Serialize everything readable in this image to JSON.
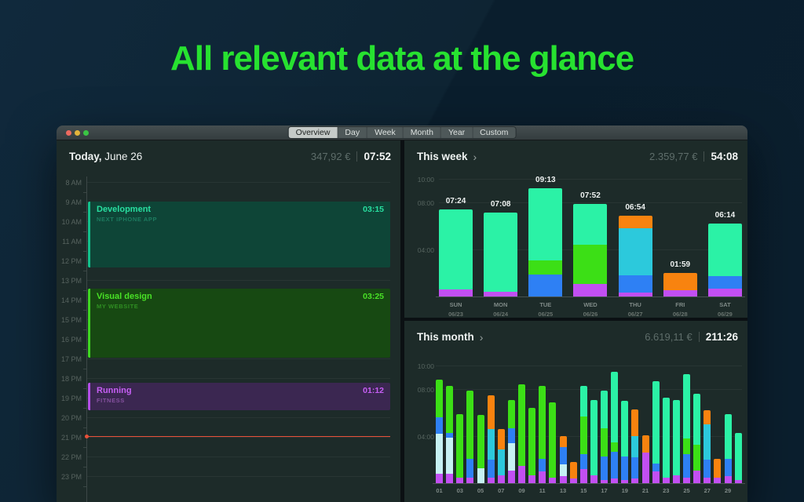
{
  "page": {
    "headline": "All relevant data at the glance"
  },
  "colors": {
    "headline": "#27e230",
    "panel_bg": "#1d2b29",
    "now_line": "#e85039",
    "traffic_lights": {
      "close": "#ed6a5f",
      "minimize": "#e2b43b",
      "zoom": "#3ac544"
    },
    "palette": {
      "m": "#2bf2a6",
      "g": "#3cdf16",
      "b": "#2e80f4",
      "c": "#2cc9dc",
      "lc": "#c6f1f3",
      "o": "#f8830f",
      "p": "#c24ff2"
    },
    "event_themes": {
      "teal": {
        "bg": "#0e4537",
        "border": "#13c18c",
        "title": "#28dfa0",
        "sub": "#1d7c60"
      },
      "green": {
        "bg": "#174912",
        "border": "#3fd622",
        "title": "#49e126",
        "sub": "#2f8f22"
      },
      "purple": {
        "bg": "#3b2751",
        "border": "#b44fe8",
        "title": "#c75ff5",
        "sub": "#85519f"
      }
    }
  },
  "window": {
    "tabs": [
      {
        "label": "Overview",
        "selected": true
      },
      {
        "label": "Day",
        "selected": false
      },
      {
        "label": "Week",
        "selected": false
      },
      {
        "label": "Month",
        "selected": false
      },
      {
        "label": "Year",
        "selected": false
      },
      {
        "label": "Custom",
        "selected": false
      }
    ]
  },
  "today": {
    "title_bold": "Today,",
    "title_rest": " June 26",
    "amount": "347,92 €",
    "duration": "07:52",
    "hours": [
      "8 AM",
      "9 AM",
      "10 AM",
      "11 AM",
      "12 PM",
      "13 PM",
      "14 PM",
      "15 PM",
      "16 PM",
      "17 PM",
      "18 PM",
      "19 PM",
      "20 PM",
      "21 PM",
      "22 PM",
      "23 PM"
    ],
    "events": [
      {
        "name": "Development",
        "project": "NEXT IPHONE APP",
        "duration": "03:15",
        "start": 9.0,
        "end": 12.35,
        "theme": "teal"
      },
      {
        "name": "Visual design",
        "project": "MY WEBSITE",
        "duration": "03:25",
        "start": 13.45,
        "end": 16.95,
        "theme": "green"
      },
      {
        "name": "Running",
        "project": "FITNESS",
        "duration": "01:12",
        "start": 18.25,
        "end": 19.65,
        "theme": "purple"
      }
    ],
    "now_line_hour": 20.95
  },
  "chart_data": [
    {
      "type": "bar",
      "stacked": true,
      "title": "This week",
      "chevron": "›",
      "amount": "2.359,77 €",
      "total_duration": "54:08",
      "ylim": [
        0,
        10
      ],
      "ytick_labels": [
        "10:00",
        "08:00",
        "04:00"
      ],
      "ytick_hours": [
        10,
        8,
        4
      ],
      "grid": true,
      "legend": "none",
      "categories": [
        [
          "SUN",
          "06/23"
        ],
        [
          "MON",
          "06/24"
        ],
        [
          "TUE",
          "06/25"
        ],
        [
          "WED",
          "06/26"
        ],
        [
          "THU",
          "06/27"
        ],
        [
          "FRI",
          "06/28"
        ],
        [
          "SAT",
          "06/29"
        ]
      ],
      "bar_value_labels": [
        "07:24",
        "07:08",
        "09:13",
        "07:52",
        "06:54",
        "01:59",
        "06:14"
      ],
      "bars": [
        {
          "segments": [
            [
              "p",
              0.6
            ],
            [
              "m",
              6.8
            ]
          ]
        },
        {
          "segments": [
            [
              "p",
              0.4
            ],
            [
              "m",
              6.73
            ]
          ]
        },
        {
          "segments": [
            [
              "b",
              1.9
            ],
            [
              "g",
              1.2
            ],
            [
              "m",
              6.12
            ]
          ]
        },
        {
          "segments": [
            [
              "p",
              1.1
            ],
            [
              "g",
              3.3
            ],
            [
              "m",
              3.47
            ]
          ]
        },
        {
          "segments": [
            [
              "p",
              0.35
            ],
            [
              "b",
              1.45
            ],
            [
              "c",
              4.0
            ],
            [
              "o",
              1.1
            ]
          ]
        },
        {
          "segments": [
            [
              "p",
              0.55
            ],
            [
              "o",
              1.43
            ]
          ]
        },
        {
          "segments": [
            [
              "p",
              0.65
            ],
            [
              "b",
              1.1
            ],
            [
              "m",
              4.48
            ]
          ]
        }
      ]
    },
    {
      "type": "bar",
      "stacked": true,
      "title": "This month",
      "chevron": "›",
      "amount": "6.619,11 €",
      "total_duration": "211:26",
      "ylim": [
        0,
        10
      ],
      "ytick_labels": [
        "10:00",
        "08:00",
        "04:00"
      ],
      "ytick_hours": [
        10,
        8,
        4
      ],
      "grid": true,
      "legend": "none",
      "xtick_labels": [
        "01",
        "03",
        "05",
        "07",
        "09",
        "11",
        "13",
        "15",
        "17",
        "19",
        "21",
        "23",
        "25",
        "27",
        "29"
      ],
      "bars": [
        {
          "day": "01",
          "segments": [
            [
              "p",
              0.8
            ],
            [
              "lc",
              3.4
            ],
            [
              "b",
              1.4
            ],
            [
              "g",
              3.2
            ]
          ]
        },
        {
          "day": "02",
          "segments": [
            [
              "p",
              0.8
            ],
            [
              "lc",
              3.1
            ],
            [
              "b",
              0.4
            ],
            [
              "g",
              4.0
            ]
          ]
        },
        {
          "day": "03",
          "segments": [
            [
              "p",
              0.5
            ],
            [
              "g",
              5.4
            ]
          ]
        },
        {
          "day": "04",
          "segments": [
            [
              "p",
              0.5
            ],
            [
              "b",
              1.6
            ],
            [
              "g",
              5.8
            ]
          ]
        },
        {
          "day": "05",
          "segments": [
            [
              "lc",
              1.3
            ],
            [
              "g",
              4.5
            ]
          ]
        },
        {
          "day": "06",
          "segments": [
            [
              "p",
              0.5
            ],
            [
              "b",
              1.5
            ],
            [
              "c",
              2.6
            ],
            [
              "o",
              2.9
            ]
          ]
        },
        {
          "day": "07",
          "segments": [
            [
              "p",
              0.7
            ],
            [
              "c",
              2.2
            ],
            [
              "o",
              1.7
            ]
          ]
        },
        {
          "day": "08",
          "segments": [
            [
              "p",
              1.1
            ],
            [
              "lc",
              2.3
            ],
            [
              "b",
              1.3
            ],
            [
              "g",
              2.4
            ]
          ]
        },
        {
          "day": "09",
          "segments": [
            [
              "p",
              1.5
            ],
            [
              "g",
              6.9
            ]
          ]
        },
        {
          "day": "10",
          "segments": [
            [
              "p",
              0.7
            ],
            [
              "g",
              5.7
            ]
          ]
        },
        {
          "day": "11",
          "segments": [
            [
              "p",
              1.0
            ],
            [
              "b",
              1.1
            ],
            [
              "g",
              6.2
            ]
          ]
        },
        {
          "day": "12",
          "segments": [
            [
              "p",
              0.5
            ],
            [
              "g",
              6.4
            ]
          ]
        },
        {
          "day": "13",
          "segments": [
            [
              "p",
              0.6
            ],
            [
              "lc",
              1.0
            ],
            [
              "b",
              1.5
            ],
            [
              "o",
              0.9
            ]
          ]
        },
        {
          "day": "14",
          "segments": [
            [
              "p",
              0.4
            ],
            [
              "o",
              1.4
            ]
          ]
        },
        {
          "day": "15",
          "segments": [
            [
              "p",
              1.2
            ],
            [
              "b",
              1.3
            ],
            [
              "g",
              3.2
            ],
            [
              "m",
              2.6
            ]
          ]
        },
        {
          "day": "16",
          "segments": [
            [
              "p",
              0.7
            ],
            [
              "m",
              6.4
            ]
          ]
        },
        {
          "day": "17",
          "segments": [
            [
              "p",
              0.3
            ],
            [
              "b",
              2.0
            ],
            [
              "g",
              2.4
            ],
            [
              "m",
              3.2
            ]
          ]
        },
        {
          "day": "18",
          "segments": [
            [
              "p",
              0.4
            ],
            [
              "b",
              2.3
            ],
            [
              "g",
              0.8
            ],
            [
              "m",
              6.0
            ]
          ]
        },
        {
          "day": "19",
          "segments": [
            [
              "p",
              0.3
            ],
            [
              "b",
              2.0
            ],
            [
              "m",
              4.7
            ]
          ]
        },
        {
          "day": "20",
          "segments": [
            [
              "p",
              0.4
            ],
            [
              "b",
              1.8
            ],
            [
              "c",
              1.8
            ],
            [
              "o",
              2.3
            ]
          ]
        },
        {
          "day": "21",
          "segments": [
            [
              "p",
              2.6
            ],
            [
              "o",
              1.5
            ]
          ]
        },
        {
          "day": "22",
          "segments": [
            [
              "p",
              1.0
            ],
            [
              "b",
              0.7
            ],
            [
              "m",
              7.0
            ]
          ]
        },
        {
          "day": "23",
          "segments": [
            [
              "p",
              0.5
            ],
            [
              "m",
              6.8
            ]
          ]
        },
        {
          "day": "24",
          "segments": [
            [
              "p",
              0.7
            ],
            [
              "m",
              6.4
            ]
          ]
        },
        {
          "day": "25",
          "segments": [
            [
              "p",
              0.5
            ],
            [
              "b",
              2.0
            ],
            [
              "g",
              1.3
            ],
            [
              "m",
              5.5
            ]
          ]
        },
        {
          "day": "26",
          "segments": [
            [
              "p",
              1.1
            ],
            [
              "g",
              2.2
            ],
            [
              "m",
              4.3
            ]
          ]
        },
        {
          "day": "27",
          "segments": [
            [
              "p",
              0.5
            ],
            [
              "b",
              1.5
            ],
            [
              "c",
              3.0
            ],
            [
              "o",
              1.2
            ]
          ]
        },
        {
          "day": "28",
          "segments": [
            [
              "p",
              0.5
            ],
            [
              "o",
              1.6
            ]
          ]
        },
        {
          "day": "29",
          "segments": [
            [
              "p",
              0.6
            ],
            [
              "b",
              1.5
            ],
            [
              "m",
              3.8
            ]
          ]
        },
        {
          "day": "30",
          "segments": [
            [
              "p",
              0.3
            ],
            [
              "m",
              4.0
            ]
          ]
        }
      ]
    }
  ]
}
